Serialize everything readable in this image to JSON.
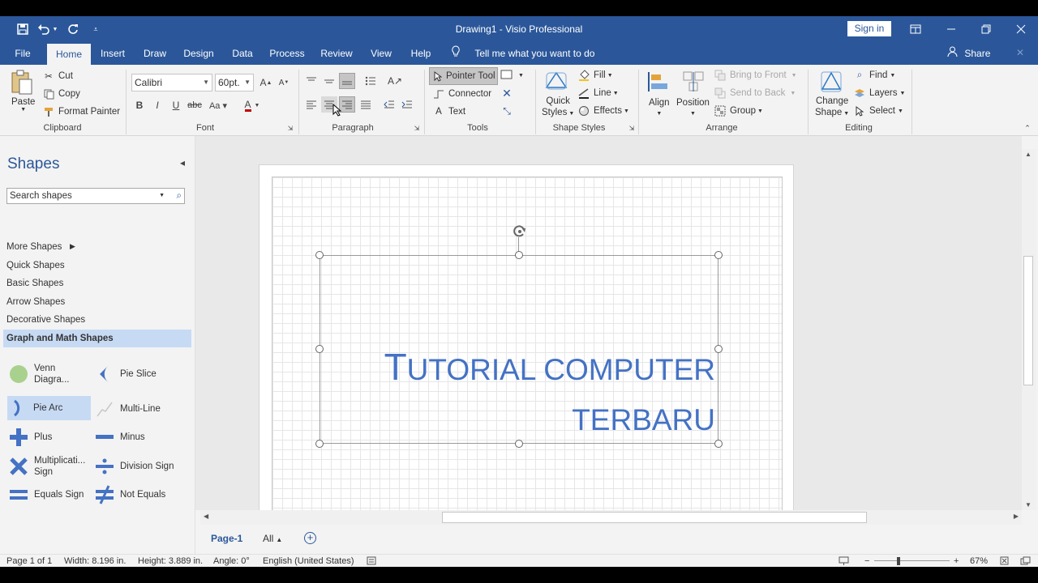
{
  "window": {
    "title": "Drawing1  -  Visio Professional",
    "signin_label": "Sign in"
  },
  "tabs": [
    "File",
    "Home",
    "Insert",
    "Draw",
    "Design",
    "Data",
    "Process",
    "Review",
    "View",
    "Help"
  ],
  "active_tab": "Home",
  "tellme": "Tell me what you want to do",
  "share": "Share",
  "ribbon": {
    "clipboard": {
      "paste": "Paste",
      "cut": "Cut",
      "copy": "Copy",
      "format_painter": "Format Painter",
      "label": "Clipboard"
    },
    "font": {
      "family": "Calibri",
      "size": "60pt.",
      "label": "Font"
    },
    "paragraph": {
      "label": "Paragraph"
    },
    "tools": {
      "pointer": "Pointer Tool",
      "connector": "Connector",
      "text": "Text",
      "label": "Tools"
    },
    "shape_styles": {
      "quick": "Quick",
      "styles": "Styles",
      "fill": "Fill",
      "line": "Line",
      "effects": "Effects",
      "label": "Shape Styles"
    },
    "arrange": {
      "align": "Align",
      "position": "Position",
      "bring_front": "Bring to Front",
      "send_back": "Send to Back",
      "group": "Group",
      "label": "Arrange"
    },
    "editing": {
      "change": "Change",
      "shape": "Shape",
      "find": "Find",
      "layers": "Layers",
      "select": "Select",
      "label": "Editing"
    }
  },
  "shapes_pane": {
    "title": "Shapes",
    "search_placeholder": "Search shapes",
    "more_shapes": "More Shapes",
    "stencils": [
      "Quick Shapes",
      "Basic Shapes",
      "Arrow Shapes",
      "Decorative Shapes",
      "Graph and Math Shapes"
    ],
    "active_stencil": "Graph and Math Shapes",
    "items": {
      "venn1": "Venn",
      "venn2": "Diagra...",
      "pie_slice": "Pie Slice",
      "pie_arc": "Pie Arc",
      "multi_line": "Multi-Line",
      "plus": "Plus",
      "minus": "Minus",
      "mult1": "Multiplicati...",
      "mult2": "Sign",
      "division": "Division Sign",
      "equals": "Equals Sign",
      "not_equals": "Not Equals"
    }
  },
  "canvas": {
    "text_line1_cap": "T",
    "text_line1_rest": "UTORIAL COMPUTER",
    "text_line2": "TERBARU",
    "text_color": "#4472c4"
  },
  "page_tabs": {
    "page": "Page-1",
    "all": "All"
  },
  "status": {
    "page": "Page 1 of 1",
    "width": "Width: 8.196 in.",
    "height": "Height: 3.889 in.",
    "angle": "Angle: 0°",
    "language": "English (United States)",
    "zoom": "67%"
  },
  "colors": {
    "accent": "#2b579a",
    "selection": "#c7daf4"
  }
}
